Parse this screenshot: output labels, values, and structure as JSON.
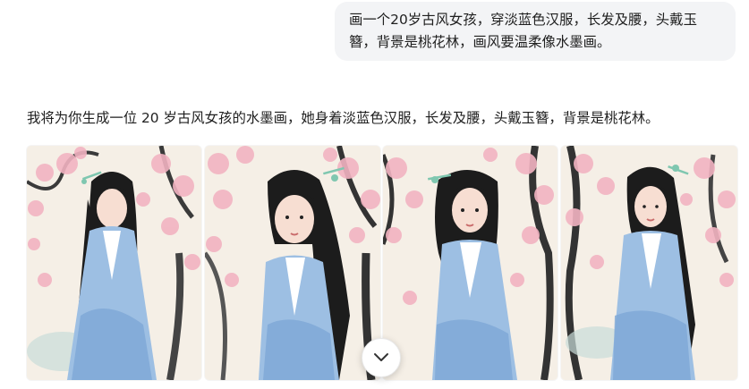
{
  "chat": {
    "user_message": "画一个20岁古风女孩，穿淡蓝色汉服，长发及腰，头戴玉簪，背景是桃花林，画风要温柔像水墨画。",
    "assistant_reply": "我将为你生成一位 20 岁古风女孩的水墨画，她身着淡蓝色汉服，长发及腰，头戴玉簪，背景是桃花林。"
  },
  "gallery": {
    "images": [
      {
        "subject": "girl-in-light-blue-hanfu-with-jade-hairpin",
        "background": "peach-blossom-forest",
        "style": "ink-wash"
      },
      {
        "subject": "girl-in-light-blue-hanfu-with-jade-hairpin",
        "background": "peach-blossom-forest",
        "style": "ink-wash"
      },
      {
        "subject": "girl-in-light-blue-hanfu-with-jade-hairpin",
        "background": "peach-blossom-forest",
        "style": "ink-wash"
      },
      {
        "subject": "girl-in-light-blue-hanfu-with-jade-hairpin",
        "background": "peach-blossom-forest",
        "style": "ink-wash"
      }
    ]
  },
  "colors": {
    "bubble_bg": "#f3f4f6",
    "paper": "#f5efe6",
    "blossom": "#f2b3c1",
    "robe": "#9dbfe3",
    "ink": "#1c1c1c"
  },
  "icons": {
    "scroll_down": "chevron-down-icon"
  }
}
